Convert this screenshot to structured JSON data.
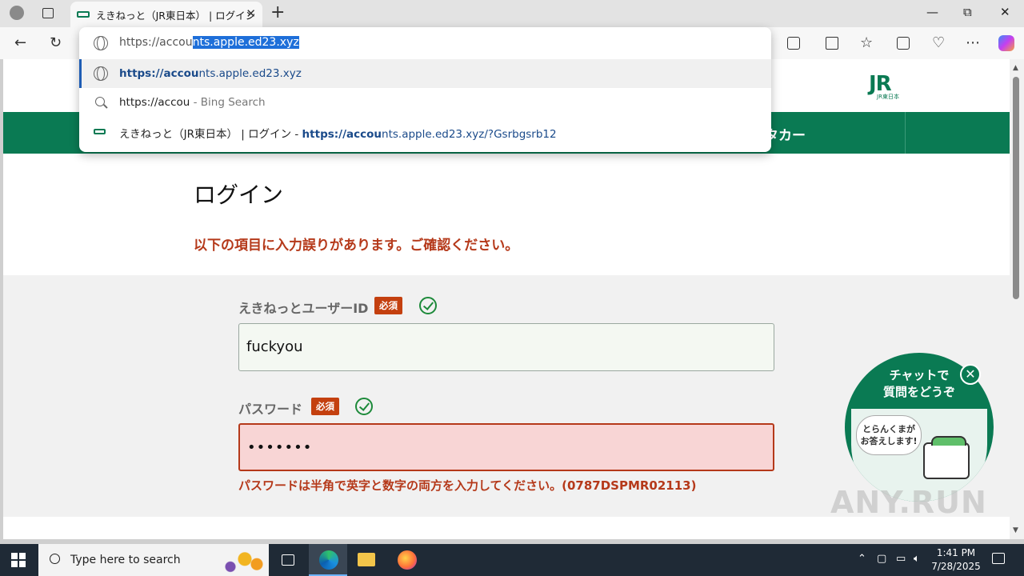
{
  "browser": {
    "tab_title": "えきねっと（JR東日本） | ログイン",
    "tab_close": "✕",
    "new_tab": "+",
    "window": {
      "minimize": "—",
      "maximize": "⧉",
      "close": "✕"
    }
  },
  "toolbar": {
    "back": "←",
    "reload": "↻"
  },
  "omnibox": {
    "typed": "https://accou",
    "autocomplete": "nts.apple.ed23.xyz",
    "suggestions": [
      {
        "bold": "https://accou",
        "rest": "nts.apple.ed23.xyz"
      },
      {
        "query": "https://accou",
        "engine": " - Bing Search"
      },
      {
        "title": "えきねっと（JR東日本） | ログイン - ",
        "bold": "https://accou",
        "rest": "nts.apple.ed23.xyz/?Gsrbgsrb12"
      }
    ]
  },
  "page": {
    "logo_text": "JR",
    "logo_sub": "JR東日本",
    "nav_rentacar": "タカー",
    "title": "ログイン",
    "error_banner": "以下の項目に入力誤りがあります。ご確認ください。",
    "userid_label": "えきねっとユーザーID",
    "required": "必須",
    "userid_value": "fuckyou",
    "password_label": "パスワード",
    "password_value": "•••••••",
    "password_error": "パスワードは半角で英字と数字の両方を入力してください。(0787DSPMR02113)"
  },
  "chat_widget": {
    "line1": "チャットで",
    "line2": "質問をどうぞ",
    "bubble_line1": "とらんくまが",
    "bubble_line2": "お答えします!",
    "close": "✕"
  },
  "watermark": "ANY.RUN",
  "taskbar": {
    "search_placeholder": "Type here to search",
    "time": "1:41 PM",
    "date": "7/28/2025"
  }
}
